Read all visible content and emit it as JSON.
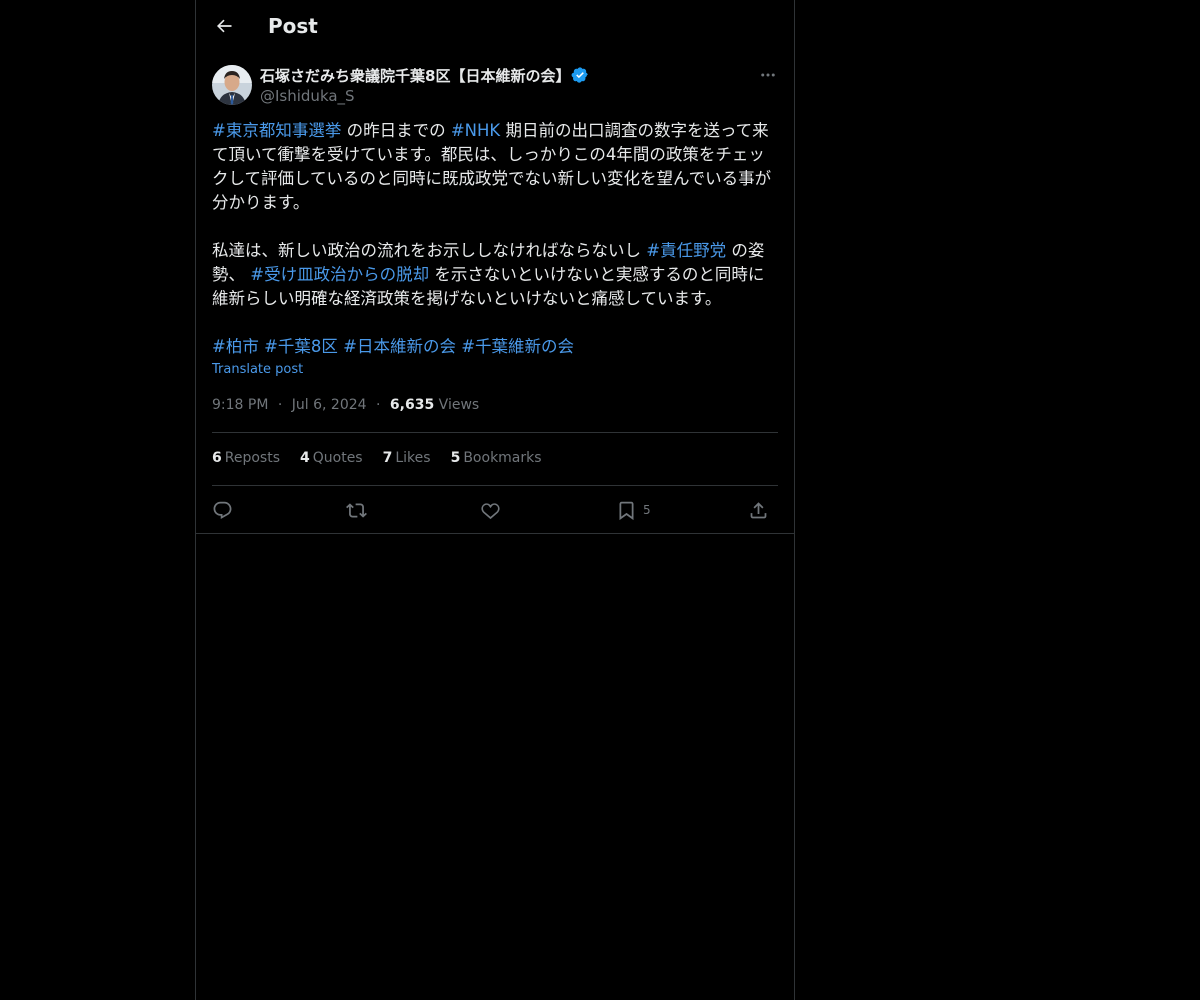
{
  "header": {
    "title": "Post"
  },
  "author": {
    "name": "石塚さだみち衆議院千葉8区【日本維新の会】",
    "handle": "@Ishiduka_S"
  },
  "body": {
    "p1": [
      {
        "t": "#東京都知事選挙",
        "tag": true
      },
      {
        "t": " の昨日までの ",
        "tag": false
      },
      {
        "t": "#NHK",
        "tag": true
      },
      {
        "t": " 期日前の出口調査の数字を送って来て頂いて衝撃を受けています。都民は、しっかりこの4年間の政策をチェックして評価しているのと同時に既成政党でない新しい変化を望んでいる事が分かります。",
        "tag": false
      }
    ],
    "p2": [
      {
        "t": "私達は、新しい政治の流れをお示ししなければならないし ",
        "tag": false
      },
      {
        "t": "#責任野党",
        "tag": true
      },
      {
        "t": " の姿勢、 ",
        "tag": false
      },
      {
        "t": "#受け皿政治からの脱却",
        "tag": true
      },
      {
        "t": " を示さないといけないと実感するのと同時に維新らしい明確な経済政策を掲げないといけないと痛感しています。",
        "tag": false
      }
    ],
    "p3": [
      {
        "t": "#柏市",
        "tag": true
      },
      {
        "t": " ",
        "tag": false
      },
      {
        "t": "#千葉8区",
        "tag": true
      },
      {
        "t": " ",
        "tag": false
      },
      {
        "t": "#日本維新の会",
        "tag": true
      },
      {
        "t": " ",
        "tag": false
      },
      {
        "t": "#千葉維新の会",
        "tag": true
      }
    ]
  },
  "translate_label": "Translate post",
  "meta": {
    "time": "9:18 PM",
    "sep": "·",
    "date": "Jul 6, 2024",
    "views_count": "6,635",
    "views_label": "Views"
  },
  "stats": [
    {
      "count": "6",
      "label": "Reposts"
    },
    {
      "count": "4",
      "label": "Quotes"
    },
    {
      "count": "7",
      "label": "Likes"
    },
    {
      "count": "5",
      "label": "Bookmarks"
    }
  ],
  "actions": {
    "bookmark_count": "5"
  },
  "colors": {
    "background": "#000000",
    "text": "#e7e9ea",
    "muted": "#71767b",
    "link": "#4a99e9",
    "verified": "#1d9bf0",
    "border": "#2f3336"
  },
  "icons": [
    "back-arrow-icon",
    "verified-badge-icon",
    "more-icon",
    "reply-icon",
    "repost-icon",
    "like-icon",
    "bookmark-icon",
    "share-icon"
  ]
}
